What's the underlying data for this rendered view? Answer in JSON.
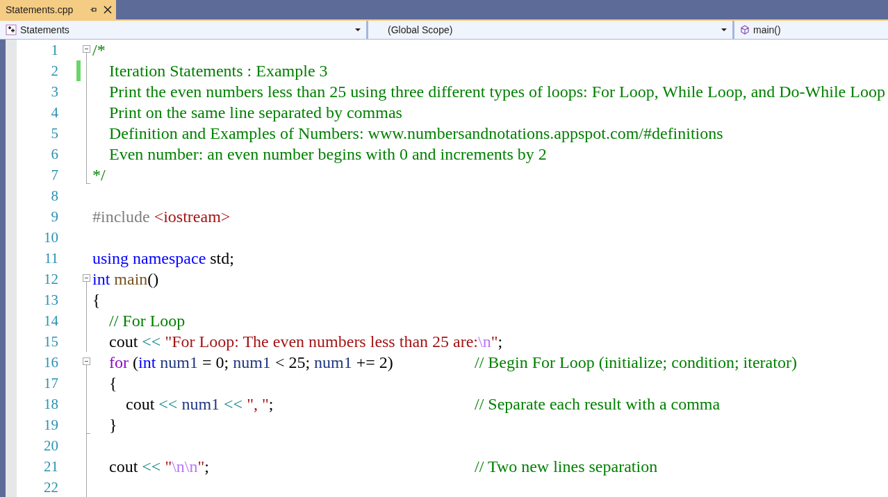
{
  "tab": {
    "title": "Statements.cpp",
    "selected": true
  },
  "navigation": [
    {
      "kind": "project",
      "text": "Statements"
    },
    {
      "kind": "scope",
      "text": "(Global Scope)"
    },
    {
      "kind": "member",
      "text": "main()"
    }
  ],
  "lines": [
    {
      "number": "1",
      "kind": "fold_start",
      "expanded": true,
      "tokens": [
        {
          "kind": "comment",
          "text": "/*"
        }
      ]
    },
    {
      "number": "2",
      "kind": "fold_inside",
      "modified": true,
      "tokens": [
        {
          "kind": "comment",
          "text": "\tIteration Statements : Example 3"
        }
      ]
    },
    {
      "number": "3",
      "kind": "fold_inside",
      "tokens": [
        {
          "kind": "comment",
          "text": "\tPrint the even numbers less than 25 using three different types of loops: For Loop, While Loop, and Do-While Loop"
        }
      ]
    },
    {
      "number": "4",
      "kind": "fold_inside",
      "tokens": [
        {
          "kind": "comment",
          "text": "\tPrint on the same line separated by commas"
        }
      ]
    },
    {
      "number": "5",
      "kind": "fold_inside",
      "tokens": [
        {
          "kind": "comment",
          "text": "\tDefinition and Examples of Numbers: www.numbersandnotations.appspot.com/#definitions"
        }
      ]
    },
    {
      "number": "6",
      "kind": "fold_inside",
      "tokens": [
        {
          "kind": "comment",
          "text": "\tEven number: an even number begins with 0 and increments by 2"
        }
      ]
    },
    {
      "number": "7",
      "kind": "fold_end",
      "tokens": [
        {
          "kind": "comment",
          "text": "*/"
        }
      ]
    },
    {
      "number": "8",
      "kind": "plain"
    },
    {
      "number": "9",
      "kind": "plain",
      "tokens": [
        {
          "kind": "preprocessor",
          "text": "#include "
        },
        {
          "kind": "string",
          "text": "<iostream>"
        }
      ]
    },
    {
      "number": "10",
      "kind": "plain"
    },
    {
      "number": "11",
      "kind": "plain",
      "tokens": [
        {
          "kind": "keyword",
          "text": "using namespace "
        },
        {
          "kind": "plain",
          "text": "std;"
        }
      ]
    },
    {
      "number": "12",
      "kind": "fold_start",
      "expanded": true,
      "tokens": [
        {
          "kind": "keyword",
          "text": "int "
        },
        {
          "kind": "function",
          "text": "main"
        },
        {
          "kind": "plain",
          "text": "()"
        }
      ]
    },
    {
      "number": "13",
      "kind": "fold_inside",
      "tokens": [
        {
          "kind": "plain",
          "text": "{"
        }
      ]
    },
    {
      "number": "14",
      "kind": "fold_inside",
      "tokens": [
        {
          "kind": "comment",
          "text": "\t// For Loop"
        }
      ]
    },
    {
      "number": "15",
      "kind": "fold_inside",
      "tokens": [
        {
          "kind": "plain",
          "text": "\tcout "
        },
        {
          "kind": "operator",
          "text": "<< "
        },
        {
          "kind": "string",
          "text": "\"For Loop: The even numbers less than 25 are:"
        },
        {
          "kind": "escape",
          "text": "\\n"
        },
        {
          "kind": "string",
          "text": "\""
        },
        {
          "kind": "plain",
          "text": ";"
        }
      ]
    },
    {
      "number": "16",
      "kind": "fold_start",
      "expanded": true,
      "tokens": [
        {
          "kind": "control",
          "text": "\tfor "
        },
        {
          "kind": "plain",
          "text": "("
        },
        {
          "kind": "keyword",
          "text": "int "
        },
        {
          "kind": "variable",
          "text": "num1"
        },
        {
          "kind": "plain",
          "text": " = 0; "
        },
        {
          "kind": "variable",
          "text": "num1"
        },
        {
          "kind": "plain",
          "text": " < 25; "
        },
        {
          "kind": "variable",
          "text": "num1"
        },
        {
          "kind": "plain",
          "text": " += 2)"
        }
      ],
      "comment": "// Begin For Loop (initialize; condition; iterator)"
    },
    {
      "number": "17",
      "kind": "fold_inside",
      "tokens": [
        {
          "kind": "plain",
          "text": "\t{"
        }
      ]
    },
    {
      "number": "18",
      "kind": "fold_inside",
      "tokens": [
        {
          "kind": "plain",
          "text": "\t\tcout "
        },
        {
          "kind": "operator",
          "text": "<< "
        },
        {
          "kind": "variable",
          "text": "num1 "
        },
        {
          "kind": "operator",
          "text": "<< "
        },
        {
          "kind": "string",
          "text": "\", \""
        },
        {
          "kind": "plain",
          "text": ";"
        }
      ],
      "comment": "// Separate each result with a comma"
    },
    {
      "number": "19",
      "kind": "fold_inside_end",
      "tokens": [
        {
          "kind": "plain",
          "text": "\t}"
        }
      ]
    },
    {
      "number": "20",
      "kind": "fold_inside"
    },
    {
      "number": "21",
      "kind": "fold_inside",
      "tokens": [
        {
          "kind": "plain",
          "text": "\tcout "
        },
        {
          "kind": "operator",
          "text": "<< "
        },
        {
          "kind": "string",
          "text": "\""
        },
        {
          "kind": "escape",
          "text": "\\n\\n"
        },
        {
          "kind": "string",
          "text": "\""
        },
        {
          "kind": "plain",
          "text": ";"
        }
      ],
      "comment": "// Two new lines separation"
    },
    {
      "number": "22",
      "kind": "fold_inside"
    }
  ]
}
